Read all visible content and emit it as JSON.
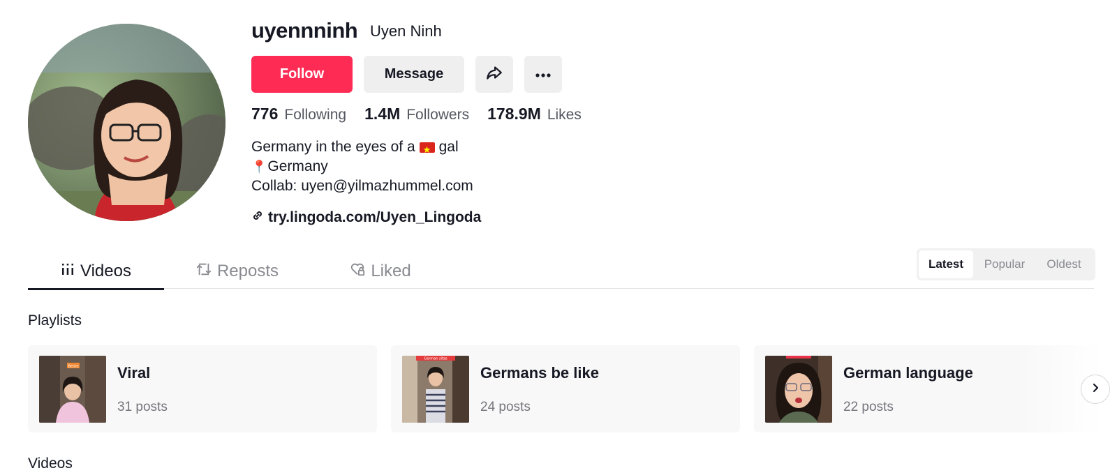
{
  "profile": {
    "username": "uyennninh",
    "display_name": "Uyen Ninh",
    "follow_label": "Follow",
    "message_label": "Message",
    "share_icon": "share-icon",
    "more_icon": "more-icon"
  },
  "stats": [
    {
      "value": "776",
      "label": "Following"
    },
    {
      "value": "1.4M",
      "label": "Followers"
    },
    {
      "value": "178.9M",
      "label": "Likes"
    }
  ],
  "bio": {
    "line1_before": "Germany in the eyes of a",
    "line1_flag": "vietnam-flag",
    "line1_after": "gal",
    "line2_icon": "📍",
    "line2": "Germany",
    "line3": "Collab: uyen@yilmazhummel.com"
  },
  "link": {
    "text": "try.lingoda.com/Uyen_Lingoda",
    "icon": "link-icon"
  },
  "tabs": [
    {
      "label": "Videos",
      "icon": "grid-icon",
      "active": true
    },
    {
      "label": "Reposts",
      "icon": "repost-icon",
      "active": false
    },
    {
      "label": "Liked",
      "icon": "heart-lock-icon",
      "active": false
    }
  ],
  "sort": {
    "options": [
      "Latest",
      "Popular",
      "Oldest"
    ],
    "selected": "Latest"
  },
  "sections": {
    "playlists": "Playlists",
    "videos": "Videos"
  },
  "playlists": [
    {
      "title": "Viral",
      "count": "31 posts",
      "thumb_text": "Beste"
    },
    {
      "title": "Germans be like",
      "count": "24 posts",
      "thumb_text": "German sitze"
    },
    {
      "title": "German language",
      "count": "22 posts",
      "thumb_text": ""
    }
  ],
  "colors": {
    "accent": "#fe2c55",
    "text": "#161823",
    "muted": "#8a8b91"
  }
}
